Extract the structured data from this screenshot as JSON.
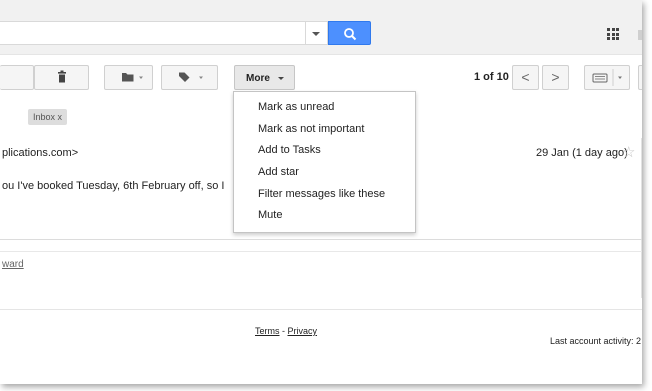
{
  "header": {
    "search_dropdown_icon": "caret-down-icon",
    "search_button_icon": "search-icon",
    "apps_icon": "apps-grid-icon",
    "accent_color": "#4d90fe"
  },
  "toolbar": {
    "delete_icon": "trash-icon",
    "move_icon": "folder-icon",
    "labels_icon": "label-tag-icon",
    "more_label": "More",
    "pager_text": "1 of 10",
    "prev_label": "<",
    "next_label": ">",
    "input_tools_icon": "keyboard-icon"
  },
  "message": {
    "label_chip": "Inbox   x",
    "sender_fragment": "plications.com>",
    "date": "29 Jan (1 day ago)",
    "star": "☆",
    "body_fragment": "ou I've booked Tuesday, 6th February off, so I",
    "forward_fragment": "ward"
  },
  "more_menu": {
    "items": [
      {
        "label": "Mark as unread"
      },
      {
        "label": "Mark as not important"
      },
      {
        "label": "Add to Tasks"
      },
      {
        "label": "Add star"
      },
      {
        "label": "Filter messages like these"
      },
      {
        "label": "Mute"
      }
    ]
  },
  "footer": {
    "terms": "Terms",
    "separator": " - ",
    "privacy": "Privacy",
    "last_activity": "Last account activity: 2"
  }
}
